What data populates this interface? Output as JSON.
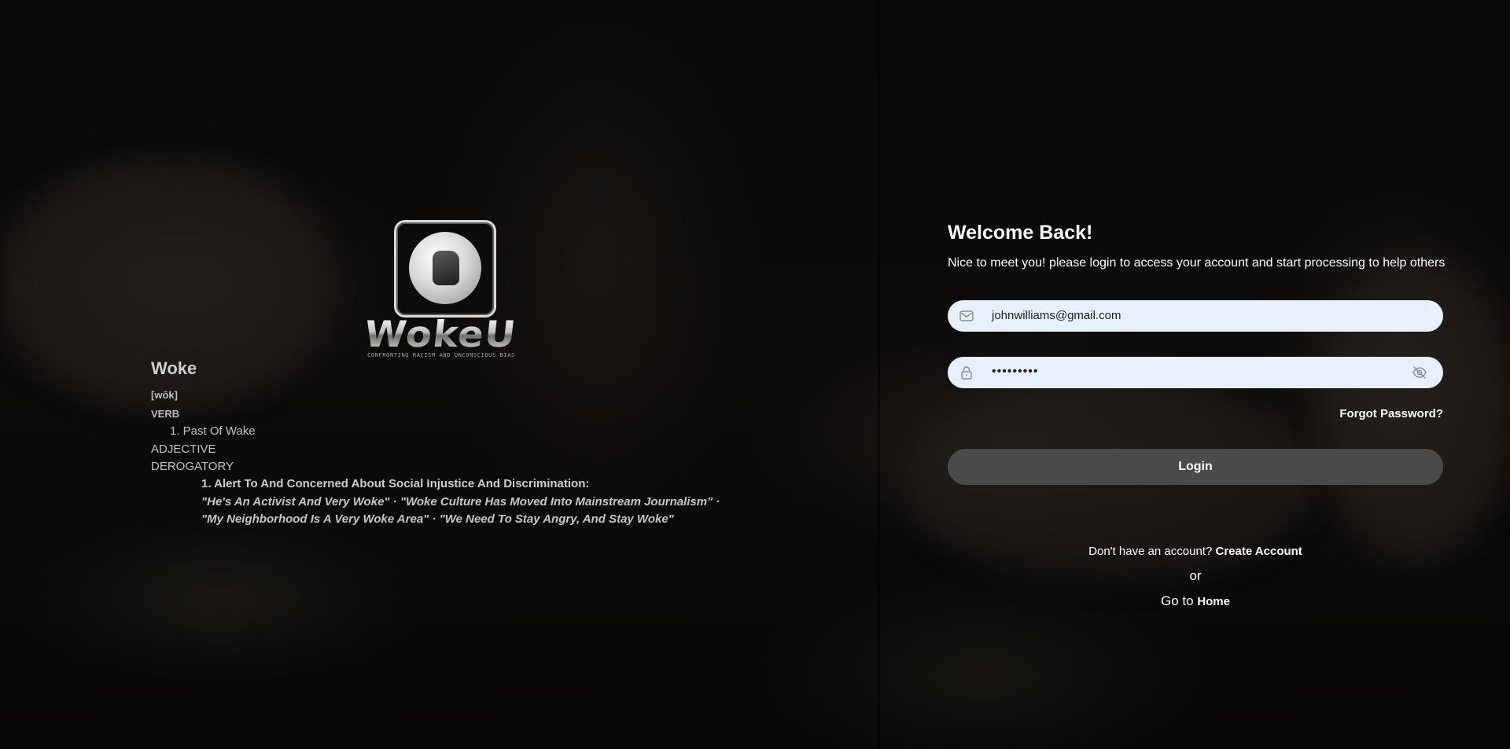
{
  "brand": {
    "logo_name": "WokeU",
    "logo_tagline": "CONFRONTING RACISM AND UNCONSCIOUS BIAS"
  },
  "definition": {
    "word": "Woke",
    "pronunciation": "[wōk]",
    "verb_label": "VERB",
    "sense1": "1. Past Of Wake",
    "adjective_label": "ADJECTIVE",
    "derogatory_label": "DEROGATORY",
    "sense2": "1. Alert To And Concerned About Social Injustice And Discrimination:",
    "example_line1": "\"He's An Activist And Very Woke\" · \"Woke Culture Has Moved Into Mainstream Journalism\" ·",
    "example_line2": "\"My Neighborhood Is A Very Woke Area\" · \"We Need To Stay Angry, And Stay Woke\""
  },
  "login": {
    "title": "Welcome Back!",
    "subtitle": "Nice to meet you! please login to access your account and start processing to help others",
    "email_value": "johnwilliams@gmail.com",
    "password_value": "•••••••••",
    "forgot_label": "Forgot Password?",
    "login_label": "Login",
    "no_account_text": "Don't have an account?",
    "create_account_label": "Create Account",
    "or_text": "or",
    "goto_text": "Go to",
    "home_label": "Home"
  },
  "colors": {
    "input_background": "#e8f0fe",
    "button_background": "#4a4a4a",
    "text_primary": "#ffffff",
    "page_background": "#070605"
  },
  "icons": {
    "email": "mail-icon",
    "password": "lock-icon",
    "visibility": "eye-off-icon"
  }
}
